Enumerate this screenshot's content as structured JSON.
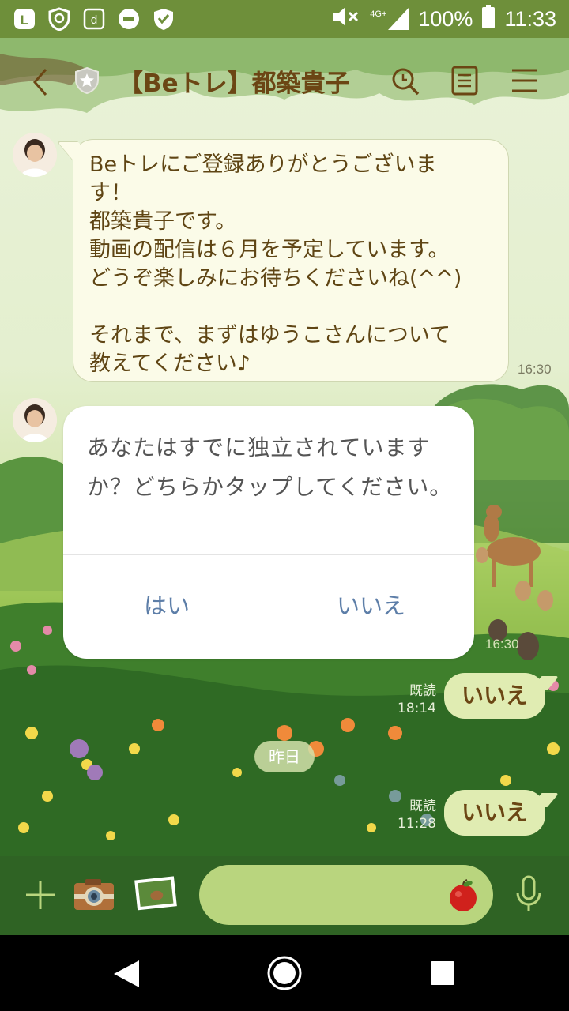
{
  "status_bar": {
    "network": "4G+",
    "battery": "100%",
    "time": "11:33"
  },
  "header": {
    "title": "【Beトレ】都築貴子"
  },
  "messages": {
    "welcome": "Beトレにご登録ありがとうございま\nす！\n都築貴子です。\n動画の配信は６月を予定しています。\nどうぞ楽しみにお待ちくださいね(^^)\n\nそれまで、まずはゆうこさんについて\n教えてください♪",
    "welcome_time": "16:30",
    "card_question": "あなたはすでに独立されていますか？どちらかタップしてください。",
    "card_time": "16:30",
    "card_yes": "はい",
    "card_no": "いいえ",
    "reply1": "いいえ",
    "reply1_read": "既読",
    "reply1_time": "18:14",
    "date_separator": "昨日",
    "reply2": "いいえ",
    "reply2_read": "既読",
    "reply2_time": "11:28"
  },
  "colors": {
    "header_text": "#6b4614",
    "status_bar": "#6e8f3a",
    "input_bar": "#2f6324",
    "link_blue": "#5d7ea8"
  },
  "icons": [
    "line-icon",
    "shield-check-icon",
    "d-icon",
    "minus-circle-icon",
    "shield-heart-icon",
    "mute-icon",
    "signal-icon",
    "battery-icon",
    "back-icon",
    "official-badge-icon",
    "search-icon",
    "note-icon",
    "menu-icon",
    "plus-icon",
    "camera-icon",
    "photo-icon",
    "apple-icon",
    "mic-icon"
  ]
}
